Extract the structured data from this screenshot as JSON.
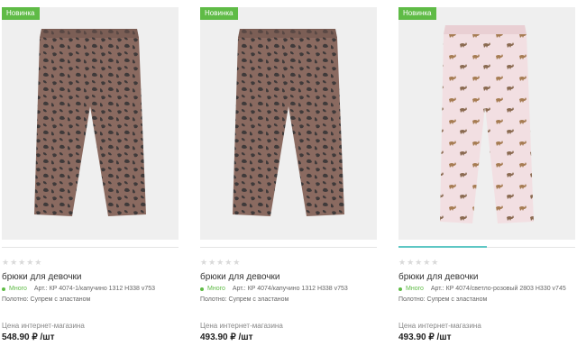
{
  "products": [
    {
      "badge": "Новинка",
      "stars": "★★★★★",
      "title": "брюки для девочки",
      "stock": "Много",
      "article": "Арт.: КР 4074-1/капучино 1312 Н338 v753",
      "fabric": "Полотно: Супрем с эластаном",
      "price_label": "Цена интернет-магазина",
      "price": "548.90 ₽ /шт",
      "image_icon": "leopard-leggings-image",
      "colors": {
        "base": "#8a6a60",
        "spot": "#3f3a3a"
      }
    },
    {
      "badge": "Новинка",
      "stars": "★★★★★",
      "title": "брюки для девочки",
      "stock": "Много",
      "article": "Арт.: КР 4074/капучино 1312 Н338 v753",
      "fabric": "Полотно: Супрем с эластаном",
      "price_label": "Цена интернет-магазина",
      "price": "493.90 ₽ /шт",
      "image_icon": "leopard-leggings-image",
      "colors": {
        "base": "#8a6a60",
        "spot": "#3f3a3a"
      }
    },
    {
      "badge": "Новинка",
      "stars": "★★★★★",
      "title": "брюки для девочки",
      "stock": "Много",
      "article": "Арт.: КР 4074/светло-розовый 2803 Н330 v745",
      "fabric": "Полотно: Супрем с эластаном",
      "price_label": "Цена интернет-магазина",
      "price": "493.90 ₽ /шт",
      "image_icon": "pink-pony-leggings-image",
      "colors": {
        "base": "#f2dfe2",
        "spot": "#a67c52"
      }
    }
  ],
  "colors": {
    "badge": "#5fbb46",
    "stock": "#5fbb46",
    "active_indicator": "#5ec7c4"
  }
}
